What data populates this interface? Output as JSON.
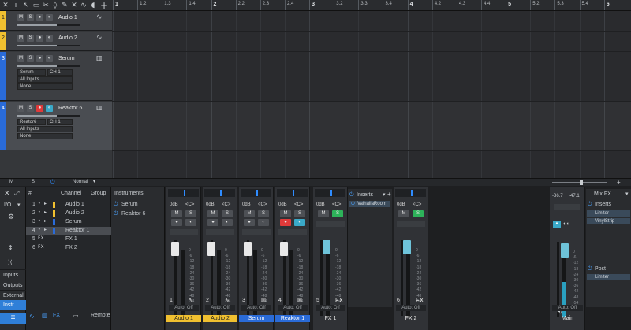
{
  "toolbar": {
    "icons": [
      "close-icon",
      "info-icon",
      "pointer-icon",
      "range-icon",
      "split-icon",
      "eraser-icon",
      "paint-icon",
      "mute-tool-icon",
      "bend-icon",
      "listen-icon",
      "add-track-icon"
    ]
  },
  "ruler": {
    "labels": [
      "1",
      "1.2",
      "1.3",
      "1.4",
      "2",
      "2.2",
      "2.3",
      "2.4",
      "3",
      "3.2",
      "3.3",
      "3.4",
      "4",
      "4.2",
      "4.3",
      "4.4",
      "5",
      "5.2",
      "5.3",
      "5.4",
      "6"
    ]
  },
  "tracks": [
    {
      "num": "1",
      "name": "Audio 1",
      "color": "#f0c030",
      "buttons": [
        "M",
        "S",
        "●",
        "◐"
      ],
      "type_icon": "waveform-icon"
    },
    {
      "num": "2",
      "name": "Audio 2",
      "color": "#f0c030",
      "buttons": [
        "M",
        "S",
        "●",
        "◐"
      ],
      "type_icon": "waveform-icon"
    },
    {
      "num": "3",
      "name": "Serum",
      "color": "#2a6bd8",
      "buttons": [
        "M",
        "S",
        "●",
        "◐"
      ],
      "type_icon": "keyboard-icon",
      "device": "Serum",
      "channel": "CH 1",
      "input": "All Inputs",
      "output": "None"
    },
    {
      "num": "4",
      "name": "Reaktor 6",
      "color": "#2a6bd8",
      "buttons": [
        "M",
        "S",
        "●",
        "◐"
      ],
      "type_icon": "keyboard-icon",
      "device": "Reator6",
      "channel": "CH 1",
      "input": "All Inputs",
      "output": "None"
    }
  ],
  "status": {
    "m": "M",
    "s": "S",
    "mode": "Normal"
  },
  "mixer_left": {
    "io": "I/O",
    "items": [
      "Inputs",
      "Outputs",
      "External",
      "Instr."
    ]
  },
  "chanlist": {
    "headers": {
      "num": "#",
      "channel": "Channel",
      "group": "Group"
    },
    "rows": [
      {
        "num": "1",
        "name": "Audio 1",
        "kind": "audio"
      },
      {
        "num": "2",
        "name": "Audio 2",
        "kind": "audio"
      },
      {
        "num": "3",
        "name": "Serum",
        "kind": "inst"
      },
      {
        "num": "4",
        "name": "Reaktor 1",
        "kind": "inst"
      },
      {
        "num": "5",
        "name": "FX 1",
        "kind": "FX"
      },
      {
        "num": "6",
        "name": "FX 2",
        "kind": "FX"
      }
    ],
    "remote": "Remote"
  },
  "instruments": {
    "title": "Instruments",
    "items": [
      "Serum",
      "Reaktor 6"
    ]
  },
  "strips": [
    {
      "num": "1",
      "name": "Audio 1",
      "level": "0dB",
      "pan": "<C>",
      "auto": "Auto: Off",
      "color": "#f0c030",
      "namecolor": "#222",
      "scale": [
        "0",
        "-6",
        "-12",
        "-18",
        "-24",
        "-30",
        "-36",
        "-42",
        "-48",
        "-54",
        "-60"
      ]
    },
    {
      "num": "2",
      "name": "Audio 2",
      "level": "0dB",
      "pan": "<C>",
      "auto": "Auto: Off",
      "color": "#f0c030",
      "namecolor": "#222",
      "scale": [
        "0",
        "-6",
        "-12",
        "-18",
        "-24",
        "-30",
        "-36",
        "-42",
        "-48",
        "-54",
        "-60"
      ]
    },
    {
      "num": "3",
      "name": "Serum",
      "level": "0dB",
      "pan": "<C>",
      "auto": "Auto: Off",
      "color": "#2a6bd8",
      "namecolor": "#fff",
      "scale": [
        "0",
        "-6",
        "-12",
        "-18",
        "-24",
        "-30",
        "-36",
        "-42",
        "-48",
        "-54",
        "-60"
      ]
    },
    {
      "num": "4",
      "name": "Reaktor 1",
      "level": "0dB",
      "pan": "<C>",
      "auto": "Auto: Off",
      "color": "#2a6bd8",
      "namecolor": "#fff",
      "scale": [
        "0",
        "-6",
        "-12",
        "-18",
        "-24",
        "-30",
        "-36",
        "-42",
        "-48",
        "-54",
        "-60"
      ]
    },
    {
      "num": "5",
      "name": "FX 1",
      "level": "0dB",
      "pan": "<C>",
      "auto": "Auto: Off",
      "fx": "FX",
      "scale": [
        "0",
        "-6",
        "-12",
        "-18",
        "-24",
        "-30",
        "-36",
        "-42",
        "-48",
        "-54",
        "-60"
      ]
    },
    {
      "num": "6",
      "name": "FX 2",
      "level": "0dB",
      "pan": "<C>",
      "auto": "Auto: Off",
      "fx": "FX",
      "scale": [
        "0",
        "-6",
        "-12",
        "-18",
        "-24",
        "-30",
        "-36",
        "-42",
        "-48",
        "-54",
        "-60"
      ]
    }
  ],
  "fx1": {
    "inserts": "Inserts",
    "plugin": "ValhallaRoom"
  },
  "main": {
    "peak_l": "-36.7",
    "peak_r": "-47.1",
    "name": "Main",
    "auto": "Auto: Off",
    "scale": [
      "0",
      "-6",
      "-12",
      "-18",
      "-24",
      "-30",
      "-36",
      "-42",
      "-48",
      "-54",
      "-60"
    ]
  },
  "mixfx": {
    "title": "Mix FX",
    "inserts": "Inserts",
    "plugins": [
      "Limiter",
      "VinylStrip"
    ],
    "post": "Post",
    "post_plugins": [
      "Limiter"
    ]
  }
}
